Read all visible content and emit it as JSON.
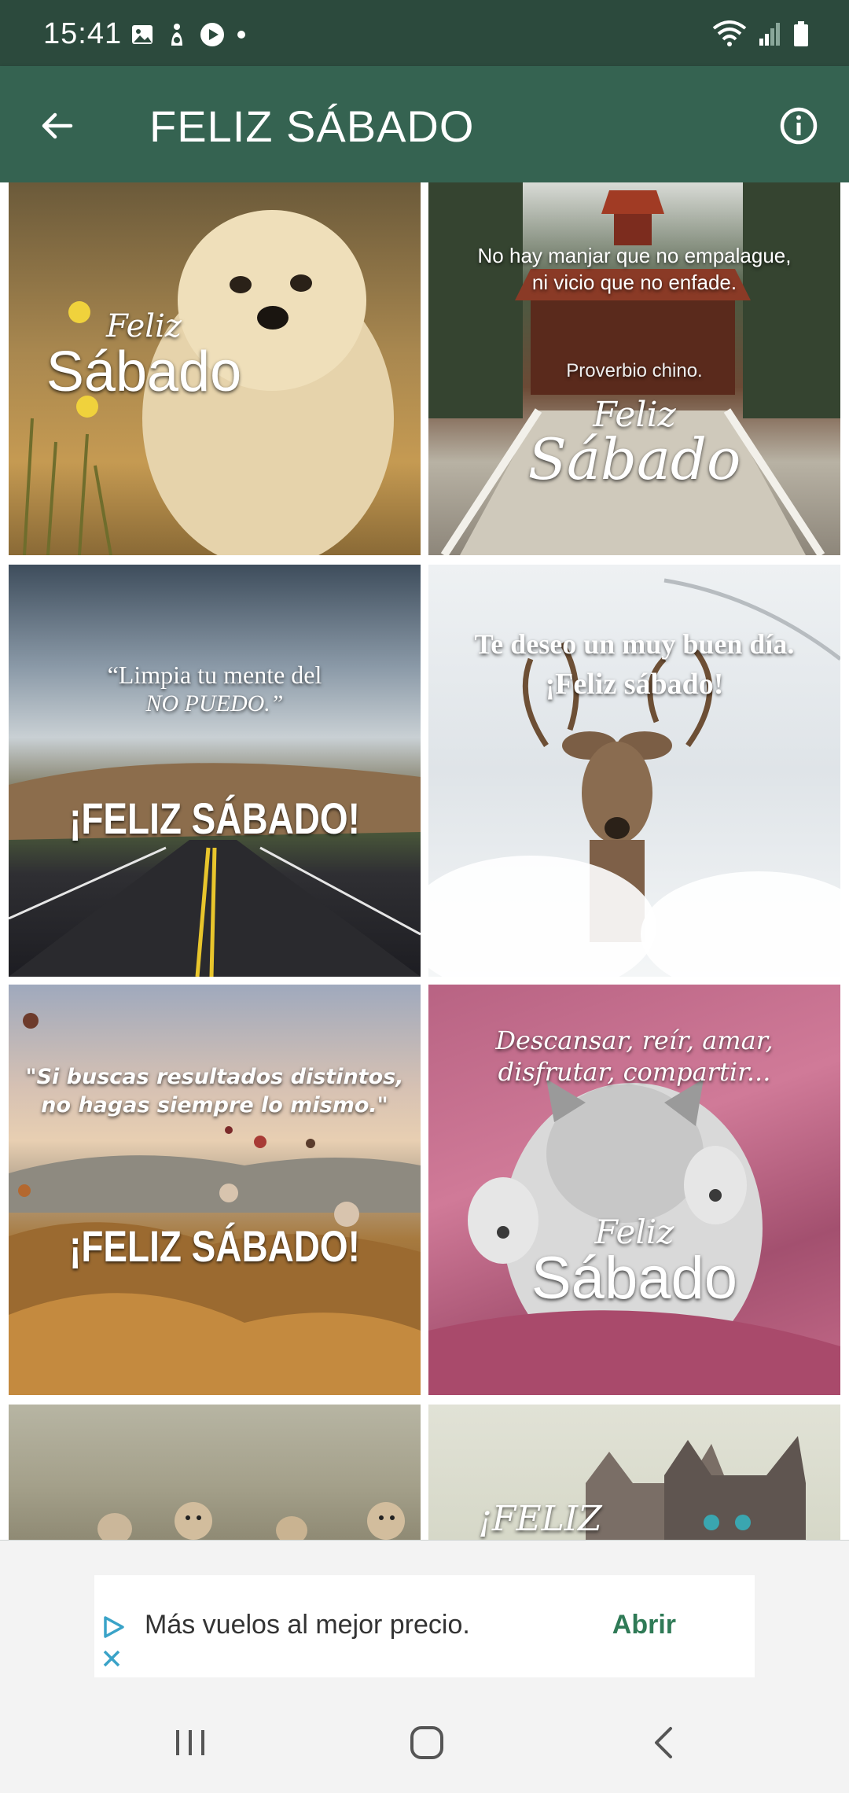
{
  "status_bar": {
    "time": "15:41",
    "left_icons": [
      "image-icon",
      "accessibility-icon",
      "play-icon",
      "dot-icon"
    ],
    "right_icons": [
      "wifi-icon",
      "signal-icon",
      "battery-icon"
    ]
  },
  "app_bar": {
    "title": "FELIZ SÁBADO",
    "back_icon": "arrow-left-icon",
    "info_icon": "info-icon",
    "color": "#356351"
  },
  "cards": [
    {
      "name": "puppy",
      "lines": [
        "Feliz",
        "Sábado"
      ]
    },
    {
      "name": "pagoda",
      "quote": [
        "No hay manjar que no empalague,",
        "ni vicio que no enfade."
      ],
      "attribution": "Proverbio chino.",
      "lines": [
        "Feliz",
        "Sábado"
      ]
    },
    {
      "name": "road",
      "quote": [
        "“Limpia tu mente del",
        "NO PUEDO.”"
      ],
      "lines": [
        "¡FELIZ SÁBADO!"
      ]
    },
    {
      "name": "deer",
      "quote": [
        "Te deseo un muy buen día.",
        "¡Feliz sábado!"
      ]
    },
    {
      "name": "balloons",
      "quote": [
        "\"Si buscas resultados distintos,",
        "no hagas siempre lo mismo.\""
      ],
      "lines": [
        "¡FELIZ SÁBADO!"
      ]
    },
    {
      "name": "kitten",
      "quote": [
        "Descansar, reír, amar,",
        "disfrutar, compartir..."
      ],
      "lines": [
        "Feliz",
        "Sábado"
      ]
    },
    {
      "name": "meerkats"
    },
    {
      "name": "kittens",
      "lines": [
        "¡FELIZ"
      ]
    }
  ],
  "ad": {
    "text": "Más vuelos al mejor precio.",
    "cta": "Abrir",
    "accent": "#2f7a56"
  },
  "nav_bar": {
    "recent_icon": "recent-apps-icon",
    "home_icon": "home-icon",
    "back_icon": "back-chevron-icon"
  }
}
